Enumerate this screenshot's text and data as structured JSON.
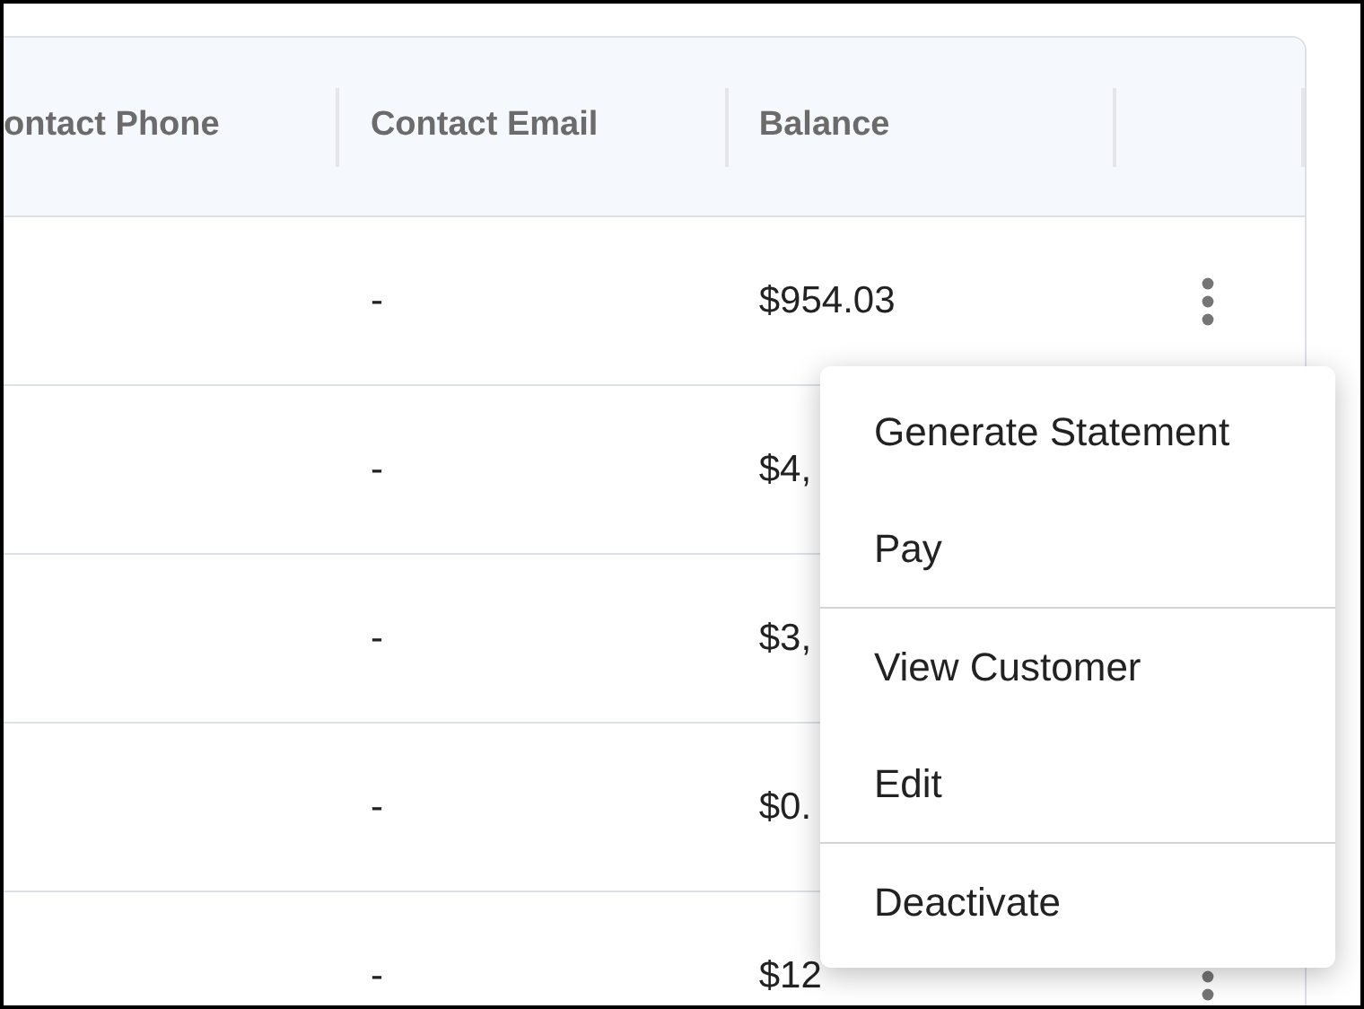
{
  "table": {
    "columns": [
      "ontact Phone",
      "Contact Email",
      "Balance"
    ],
    "rows": [
      {
        "contact_email": "-",
        "balance": "$954.03"
      },
      {
        "contact_email": "-",
        "balance": "$4,"
      },
      {
        "contact_email": "-",
        "balance": "$3,"
      },
      {
        "contact_email": "-",
        "balance": "$0."
      },
      {
        "contact_email": "-",
        "balance": "$12"
      }
    ]
  },
  "menu": {
    "groups": [
      [
        "Generate Statement",
        "Pay"
      ],
      [
        "View Customer",
        "Edit"
      ],
      [
        "Deactivate"
      ]
    ]
  }
}
